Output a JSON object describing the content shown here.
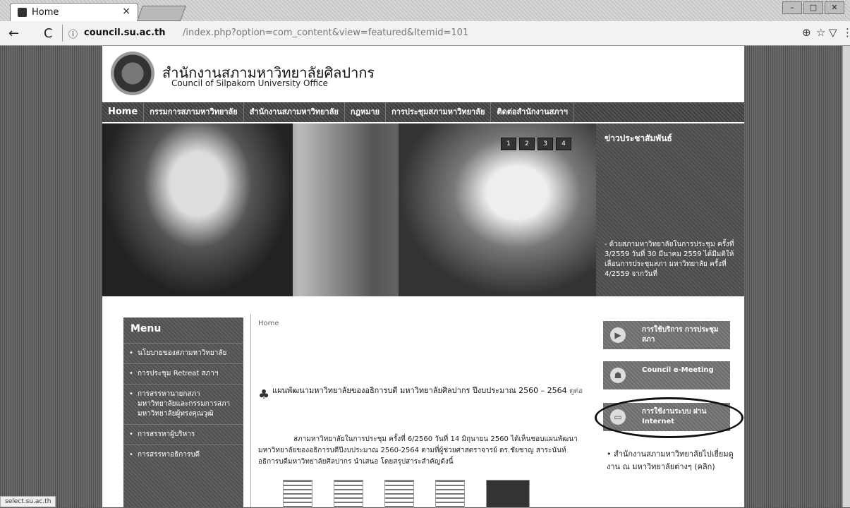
{
  "browser": {
    "tab_title": "Home",
    "tab_close": "×",
    "back": "←",
    "reload": "C",
    "info_icon": "ⓘ",
    "url_host": "council.su.ac.th",
    "url_path": "/index.php?option=com_content&view=featured&Itemid=101",
    "status_text": "select.su.ac.th",
    "icon_translate": "⊕",
    "icon_star": "☆",
    "icon_shield": "▽",
    "icon_menu": "⋮",
    "win_min": "–",
    "win_max": "□",
    "win_close": "✕"
  },
  "header": {
    "title": "สำนักงานสภามหาวิทยาลัยศิลปากร",
    "subtitle": "Council of Silpakorn University Office",
    "mark": "ﾠ"
  },
  "nav": {
    "items": [
      "Home",
      "กรรมการสภามหาวิทยาลัย",
      "สำนักงานสภามหาวิทยาลัย",
      "กฎหมาย",
      "การประชุมสภามหาวิทยาลัย",
      "ติดต่อสำนักงานสภาฯ"
    ]
  },
  "slider": {
    "dots": [
      "1",
      "2",
      "3",
      "4"
    ]
  },
  "news": {
    "title": "ข่าวประชาสัมพันธ์",
    "body": "- ด้วยสภามหาวิทยาลัยในการประชุม ครั้งที่ 3/2559 วันที่ 30 มีนาคม 2559 ได้มีมติให้เลื่อนการประชุมสภา มหาวิทยาลัย ครั้งที่ 4/2559 จากวันที่"
  },
  "menu": {
    "title": "Menu",
    "items": [
      "นโยบายของสภามหาวิทยาลัย",
      "การประชุม Retreat สภาฯ",
      "การสรรหานายกสภามหาวิทยาลัยและกรรมการสภามหาวิทยาลัยผู้ทรงคุณวุฒิ",
      "การสรรหาผู้บริหาร",
      "การสรรหาอธิการบดี"
    ],
    "bullet": "•"
  },
  "content": {
    "breadcrumb": "Home",
    "article_title": "แผนพัฒนามหาวิทยาลัยของอธิการบดี มหาวิทยาลัยศิลปากร ปีงบประมาณ 2560 – 2564",
    "article_meta": "ดูต่อ",
    "article_body": "สภามหาวิทยาลัยในการประชุม ครั้งที่ 6/2560 วันที่ 14 มิถุนายน 2560 ได้เห็นชอบแผนพัฒนามหาวิทยาลัยของอธิการบดีปีงบประมาณ 2560-2564 ตามที่ผู้ช่วยศาสตราจารย์ ดร.ชัยชาญ สาระนันท์ อธิการบดีมหาวิทยาลัยศิลปากร นำเสนอ โดยสรุปสาระสำคัญดังนี้"
  },
  "services": [
    {
      "label": "การใช้บริการ การประชุมสภา",
      "icon": "play-icon",
      "glyph": "▶"
    },
    {
      "label": "Council e-Meeting",
      "icon": "people-icon",
      "glyph": "☗"
    },
    {
      "label": "การใช้งานระบบ ผ่าน Internet",
      "icon": "monitor-icon",
      "glyph": "▭"
    }
  ],
  "side_note": "• สำนักงานสภามหาวิทยาลัยไปเยี่ยมดูงาน ณ มหาวิทยาลัยต่างๆ (คลิก)"
}
